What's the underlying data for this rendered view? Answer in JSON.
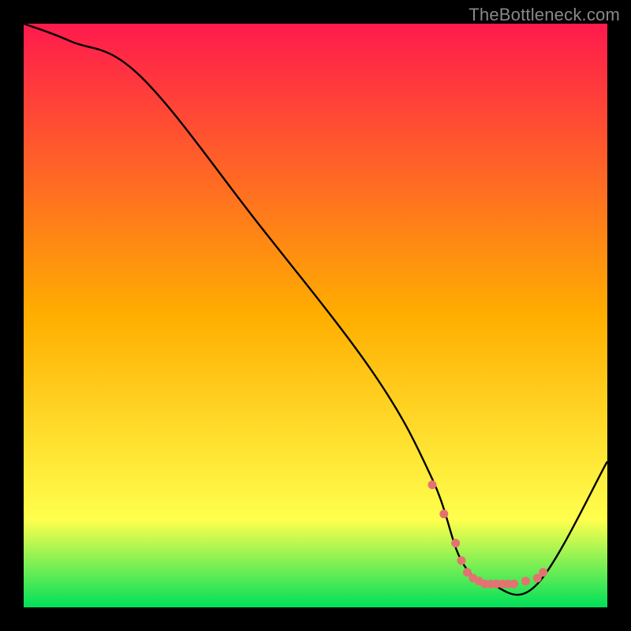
{
  "attribution": "TheBottleneck.com",
  "chart_data": {
    "type": "line",
    "title": "",
    "xlabel": "",
    "ylabel": "",
    "xlim": [
      0,
      100
    ],
    "ylim": [
      0,
      100
    ],
    "gradient_colors": [
      "#ff1a4d",
      "#ffae00",
      "#ffff4d",
      "#00e05a"
    ],
    "gradient_stops": [
      0,
      50,
      85,
      100
    ],
    "series": [
      {
        "name": "bottleneck-curve",
        "x": [
          0,
          8,
          20,
          40,
          60,
          70,
          75,
          80,
          88,
          100
        ],
        "y": [
          100,
          97,
          91,
          66,
          40,
          22,
          8,
          4,
          4,
          25
        ]
      }
    ],
    "highlight_band": {
      "name": "highlight-points",
      "color": "#e27371",
      "x": [
        70,
        72,
        74,
        75,
        76,
        77,
        78,
        79,
        80,
        81,
        82,
        83,
        84,
        86,
        88,
        89
      ],
      "y": [
        21,
        16,
        11,
        8,
        6,
        5,
        4.5,
        4,
        4,
        4,
        4,
        4,
        4,
        4.5,
        5,
        6
      ]
    }
  }
}
